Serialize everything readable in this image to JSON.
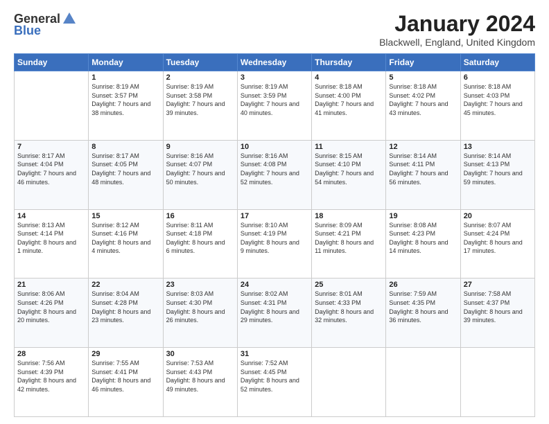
{
  "logo": {
    "general": "General",
    "blue": "Blue"
  },
  "title": "January 2024",
  "location": "Blackwell, England, United Kingdom",
  "days_of_week": [
    "Sunday",
    "Monday",
    "Tuesday",
    "Wednesday",
    "Thursday",
    "Friday",
    "Saturday"
  ],
  "weeks": [
    [
      {
        "day": "",
        "sunrise": "",
        "sunset": "",
        "daylight": ""
      },
      {
        "day": "1",
        "sunrise": "8:19 AM",
        "sunset": "3:57 PM",
        "daylight": "7 hours and 38 minutes."
      },
      {
        "day": "2",
        "sunrise": "8:19 AM",
        "sunset": "3:58 PM",
        "daylight": "7 hours and 39 minutes."
      },
      {
        "day": "3",
        "sunrise": "8:19 AM",
        "sunset": "3:59 PM",
        "daylight": "7 hours and 40 minutes."
      },
      {
        "day": "4",
        "sunrise": "8:18 AM",
        "sunset": "4:00 PM",
        "daylight": "7 hours and 41 minutes."
      },
      {
        "day": "5",
        "sunrise": "8:18 AM",
        "sunset": "4:02 PM",
        "daylight": "7 hours and 43 minutes."
      },
      {
        "day": "6",
        "sunrise": "8:18 AM",
        "sunset": "4:03 PM",
        "daylight": "7 hours and 45 minutes."
      }
    ],
    [
      {
        "day": "7",
        "sunrise": "8:17 AM",
        "sunset": "4:04 PM",
        "daylight": "7 hours and 46 minutes."
      },
      {
        "day": "8",
        "sunrise": "8:17 AM",
        "sunset": "4:05 PM",
        "daylight": "7 hours and 48 minutes."
      },
      {
        "day": "9",
        "sunrise": "8:16 AM",
        "sunset": "4:07 PM",
        "daylight": "7 hours and 50 minutes."
      },
      {
        "day": "10",
        "sunrise": "8:16 AM",
        "sunset": "4:08 PM",
        "daylight": "7 hours and 52 minutes."
      },
      {
        "day": "11",
        "sunrise": "8:15 AM",
        "sunset": "4:10 PM",
        "daylight": "7 hours and 54 minutes."
      },
      {
        "day": "12",
        "sunrise": "8:14 AM",
        "sunset": "4:11 PM",
        "daylight": "7 hours and 56 minutes."
      },
      {
        "day": "13",
        "sunrise": "8:14 AM",
        "sunset": "4:13 PM",
        "daylight": "7 hours and 59 minutes."
      }
    ],
    [
      {
        "day": "14",
        "sunrise": "8:13 AM",
        "sunset": "4:14 PM",
        "daylight": "8 hours and 1 minute."
      },
      {
        "day": "15",
        "sunrise": "8:12 AM",
        "sunset": "4:16 PM",
        "daylight": "8 hours and 4 minutes."
      },
      {
        "day": "16",
        "sunrise": "8:11 AM",
        "sunset": "4:18 PM",
        "daylight": "8 hours and 6 minutes."
      },
      {
        "day": "17",
        "sunrise": "8:10 AM",
        "sunset": "4:19 PM",
        "daylight": "8 hours and 9 minutes."
      },
      {
        "day": "18",
        "sunrise": "8:09 AM",
        "sunset": "4:21 PM",
        "daylight": "8 hours and 11 minutes."
      },
      {
        "day": "19",
        "sunrise": "8:08 AM",
        "sunset": "4:23 PM",
        "daylight": "8 hours and 14 minutes."
      },
      {
        "day": "20",
        "sunrise": "8:07 AM",
        "sunset": "4:24 PM",
        "daylight": "8 hours and 17 minutes."
      }
    ],
    [
      {
        "day": "21",
        "sunrise": "8:06 AM",
        "sunset": "4:26 PM",
        "daylight": "8 hours and 20 minutes."
      },
      {
        "day": "22",
        "sunrise": "8:04 AM",
        "sunset": "4:28 PM",
        "daylight": "8 hours and 23 minutes."
      },
      {
        "day": "23",
        "sunrise": "8:03 AM",
        "sunset": "4:30 PM",
        "daylight": "8 hours and 26 minutes."
      },
      {
        "day": "24",
        "sunrise": "8:02 AM",
        "sunset": "4:31 PM",
        "daylight": "8 hours and 29 minutes."
      },
      {
        "day": "25",
        "sunrise": "8:01 AM",
        "sunset": "4:33 PM",
        "daylight": "8 hours and 32 minutes."
      },
      {
        "day": "26",
        "sunrise": "7:59 AM",
        "sunset": "4:35 PM",
        "daylight": "8 hours and 36 minutes."
      },
      {
        "day": "27",
        "sunrise": "7:58 AM",
        "sunset": "4:37 PM",
        "daylight": "8 hours and 39 minutes."
      }
    ],
    [
      {
        "day": "28",
        "sunrise": "7:56 AM",
        "sunset": "4:39 PM",
        "daylight": "8 hours and 42 minutes."
      },
      {
        "day": "29",
        "sunrise": "7:55 AM",
        "sunset": "4:41 PM",
        "daylight": "8 hours and 46 minutes."
      },
      {
        "day": "30",
        "sunrise": "7:53 AM",
        "sunset": "4:43 PM",
        "daylight": "8 hours and 49 minutes."
      },
      {
        "day": "31",
        "sunrise": "7:52 AM",
        "sunset": "4:45 PM",
        "daylight": "8 hours and 52 minutes."
      },
      {
        "day": "",
        "sunrise": "",
        "sunset": "",
        "daylight": ""
      },
      {
        "day": "",
        "sunrise": "",
        "sunset": "",
        "daylight": ""
      },
      {
        "day": "",
        "sunrise": "",
        "sunset": "",
        "daylight": ""
      }
    ]
  ],
  "labels": {
    "sunrise": "Sunrise:",
    "sunset": "Sunset:",
    "daylight": "Daylight:"
  }
}
